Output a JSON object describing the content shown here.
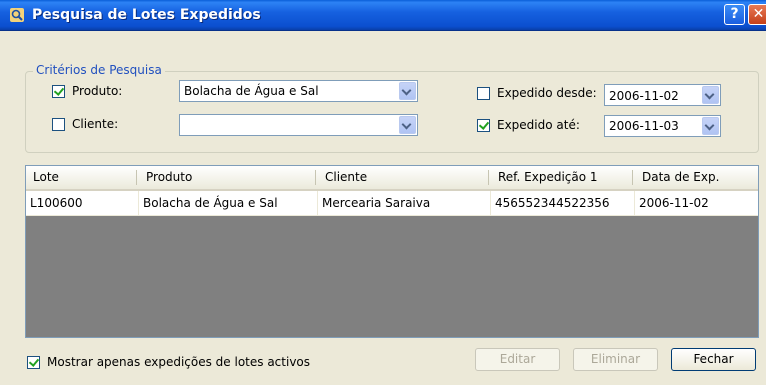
{
  "window": {
    "title": "Pesquisa de Lotes Expedidos",
    "help": "?",
    "close": "✕"
  },
  "criteria": {
    "legend": "Critérios de Pesquisa",
    "produto": {
      "label": "Produto:",
      "checked": true,
      "value": "Bolacha de Água e Sal"
    },
    "cliente": {
      "label": "Cliente:",
      "checked": false,
      "value": ""
    },
    "expedido_desde": {
      "label": "Expedido desde:",
      "checked": false,
      "value": "2006-11-02"
    },
    "expedido_ate": {
      "label": "Expedido até:",
      "checked": true,
      "value": "2006-11-03"
    }
  },
  "table": {
    "columns": [
      "Lote",
      "Produto",
      "Cliente",
      "Ref. Expedição 1",
      "Data de Exp."
    ],
    "rows": [
      [
        "L100600",
        "Bolacha de Água e Sal",
        "Mercearia Saraiva",
        "456552344522356",
        "2006-11-02"
      ]
    ]
  },
  "footer": {
    "active_only": {
      "label": "Mostrar apenas expedições de lotes activos",
      "checked": true
    },
    "edit": "Editar",
    "delete": "Eliminar",
    "close": "Fechar"
  },
  "colors": {
    "titlebar": "#0b4fcf",
    "legend": "#2150bf",
    "grid_bg": "#808080"
  }
}
